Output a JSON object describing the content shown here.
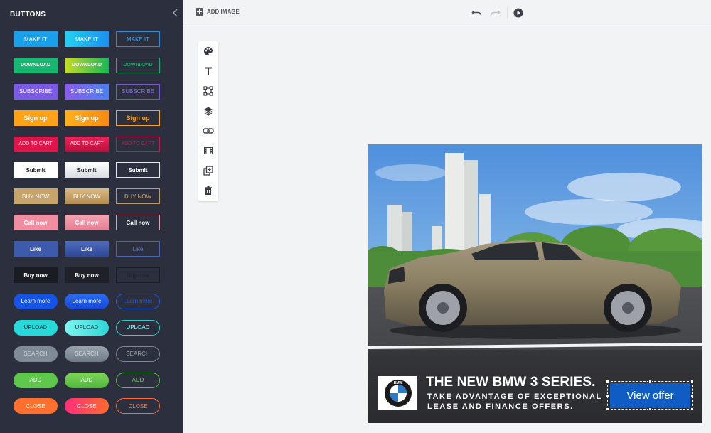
{
  "sidebar": {
    "title": "BUTTONS",
    "rows": [
      {
        "id": "make",
        "labels": [
          "MAKE IT",
          "MAKE IT",
          "MAKE IT"
        ]
      },
      {
        "id": "down",
        "labels": [
          "DOWNLOAD",
          "DOWNLOAD",
          "DOWNLOAD"
        ]
      },
      {
        "id": "sub",
        "labels": [
          "SUBSCRIBE",
          "SUBSCRIBE",
          "SUBSCRIBE"
        ]
      },
      {
        "id": "sign",
        "labels": [
          "Sign up",
          "Sign up",
          "Sign up"
        ]
      },
      {
        "id": "cart",
        "labels": [
          "ADD TO CART",
          "ADD TO CART",
          "ADD TO CART"
        ]
      },
      {
        "id": "submit",
        "labels": [
          "Submit",
          "Submit",
          "Submit"
        ]
      },
      {
        "id": "buy",
        "labels": [
          "BUY NOW",
          "BUY NOW",
          "BUY NOW"
        ]
      },
      {
        "id": "call",
        "labels": [
          "Call now",
          "Call now",
          "Call now"
        ]
      },
      {
        "id": "like",
        "labels": [
          "Like",
          "Like",
          "Like"
        ]
      },
      {
        "id": "buynow",
        "labels": [
          "Buy now",
          "Buy now",
          "Buy now"
        ]
      },
      {
        "id": "learn",
        "labels": [
          "Learn more",
          "Learn more",
          "Learn more"
        ]
      },
      {
        "id": "upload",
        "labels": [
          "UPLOAD",
          "UPLOAD",
          "UPLOAD"
        ]
      },
      {
        "id": "search",
        "labels": [
          "SEARCH",
          "SEARCH",
          "SEARCH"
        ]
      },
      {
        "id": "add",
        "labels": [
          "ADD",
          "ADD",
          "ADD"
        ]
      },
      {
        "id": "close",
        "labels": [
          "CLOSE",
          "CLOSE",
          "CLOSE"
        ]
      }
    ]
  },
  "topbar": {
    "add_image": "ADD IMAGE"
  },
  "icons": {
    "collapse": "chevron-left-icon",
    "undo": "undo-icon",
    "redo": "redo-icon",
    "play": "play-icon",
    "tools": [
      "palette-icon",
      "text-icon",
      "transform-icon",
      "layers-icon",
      "link-icon",
      "film-icon",
      "duplicate-icon",
      "trash-icon"
    ]
  },
  "ad": {
    "headline": "THE NEW BMW 3 SERIES.",
    "sub_line1": "TAKE ADVANTAGE OF EXCEPTIONAL",
    "sub_line2": "LEASE AND FINANCE OFFERS.",
    "cta": "View offer",
    "logo_letters": "BMW"
  },
  "colors": {
    "sidebar_bg": "#2b2f3e",
    "canvas_bg": "#f2f3f5",
    "cta_bg": "#0f5dc4"
  }
}
